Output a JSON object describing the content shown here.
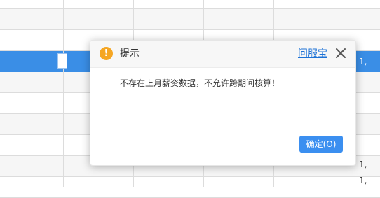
{
  "grid": {
    "selected_row_value": "1,",
    "lower_values": [
      "1,",
      "1,"
    ]
  },
  "dialog": {
    "title": "提示",
    "help_link": "问服宝",
    "message": "不存在上月薪资数据，不允许跨期间核算！",
    "ok_label": "确定(O)",
    "icon_glyph": "!",
    "close_glyph": "close-icon"
  },
  "colors": {
    "selection": "#3a8ee6",
    "warning": "#f5a623",
    "primary_button": "#3b8ff0",
    "link": "#1d72d6"
  }
}
